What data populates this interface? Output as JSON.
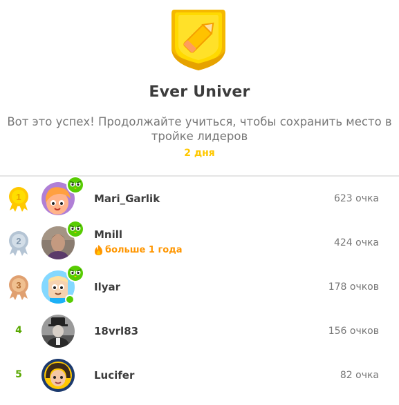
{
  "league": {
    "title": "Ever Univer",
    "subtitle": "Вот это успех! Продолжайте учиться, чтобы сохранить место в тройке лидеров",
    "days_left": "2 дня",
    "badge_color": "#ffc800"
  },
  "leaderboard": [
    {
      "rank": "1",
      "name": "Mari_Garlik",
      "xp": "623 очка",
      "medal": "gold",
      "streak": "",
      "online": false,
      "avatar_color": "#b07fd6"
    },
    {
      "rank": "2",
      "name": "Mnill",
      "xp": "424 очка",
      "medal": "silver",
      "streak": "больше 1 года",
      "online": false,
      "avatar_color": "#7a6a5c"
    },
    {
      "rank": "3",
      "name": "Ilyar",
      "xp": "178 очков",
      "medal": "bronze",
      "streak": "",
      "online": true,
      "avatar_color": "#84d8ff"
    },
    {
      "rank": "4",
      "name": "18vrl83",
      "xp": "156 очков",
      "medal": "",
      "streak": "",
      "online": false,
      "avatar_color": "#666666"
    },
    {
      "rank": "5",
      "name": "Lucifer",
      "xp": "82 очка",
      "medal": "",
      "streak": "",
      "online": false,
      "avatar_color": "#1c3a6e"
    }
  ],
  "icons": {
    "league_badge": "pencil-shield-badge-icon",
    "super_owl": "super-owl-icon",
    "streak": "flame-icon",
    "medal_1": "gold-medal-icon",
    "medal_2": "silver-medal-icon",
    "medal_3": "bronze-medal-icon"
  },
  "colors": {
    "rank_green": "#58a700",
    "streak_orange": "#ff9600",
    "owl_green": "#58cc02"
  }
}
